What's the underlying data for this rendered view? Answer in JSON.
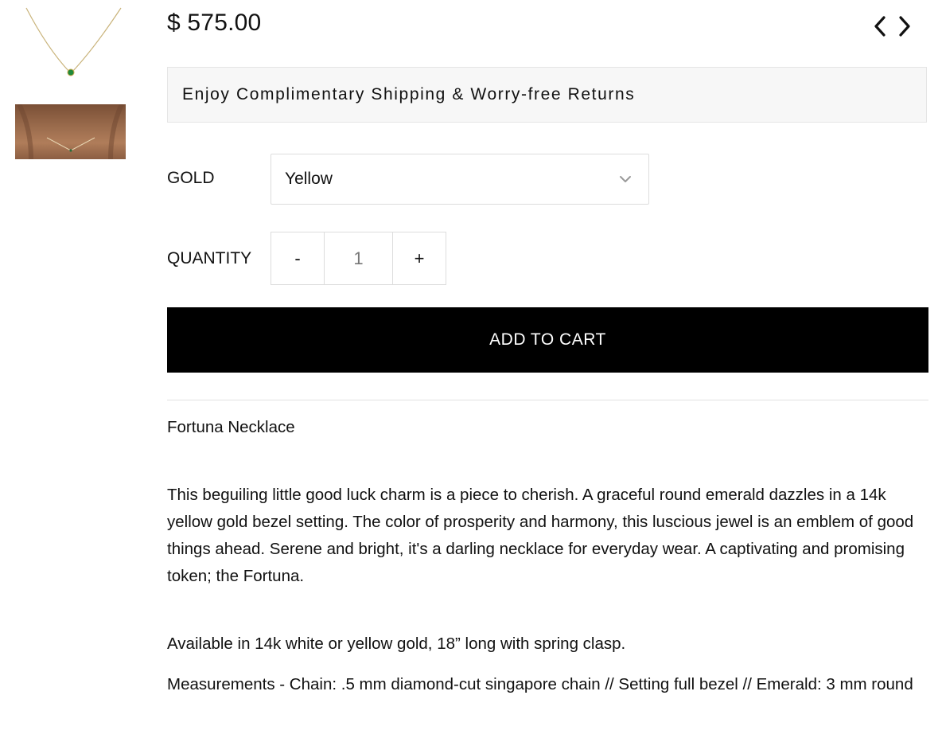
{
  "product": {
    "price": "$ 575.00",
    "title": "Fortuna Necklace"
  },
  "gallery": {
    "thumbnails": [
      {
        "name": "necklace-product-thumbnail"
      },
      {
        "name": "necklace-worn-thumbnail"
      }
    ]
  },
  "navigation": {
    "prev_icon": "chevron-left-icon",
    "next_icon": "chevron-right-icon"
  },
  "shipping_banner": "Enjoy Complimentary Shipping & Worry-free Returns",
  "options": {
    "gold_label": "GOLD",
    "gold_value": "Yellow",
    "quantity_label": "QUANTITY",
    "quantity_minus": "-",
    "quantity_value": "1",
    "quantity_plus": "+"
  },
  "cart": {
    "add_label": "ADD TO CART"
  },
  "description": {
    "body": "This beguiling little good luck charm is a piece to cherish. A graceful round emerald dazzles in a 14k yellow gold bezel setting. The color of prosperity and harmony, this luscious jewel is an emblem of good things ahead. Serene and bright, it's a darling necklace for everyday wear.  A captivating and promising token; the Fortuna.",
    "availability": "Available in 14k white or yellow gold, 18” long with spring clasp.",
    "measurements": "Measurements - Chain: .5 mm diamond-cut singapore chain // Setting full bezel // Emerald: 3 mm round"
  },
  "colors": {
    "button_bg": "#000000",
    "banner_bg": "#f7f7f7",
    "emerald": "#1f8a3a"
  }
}
